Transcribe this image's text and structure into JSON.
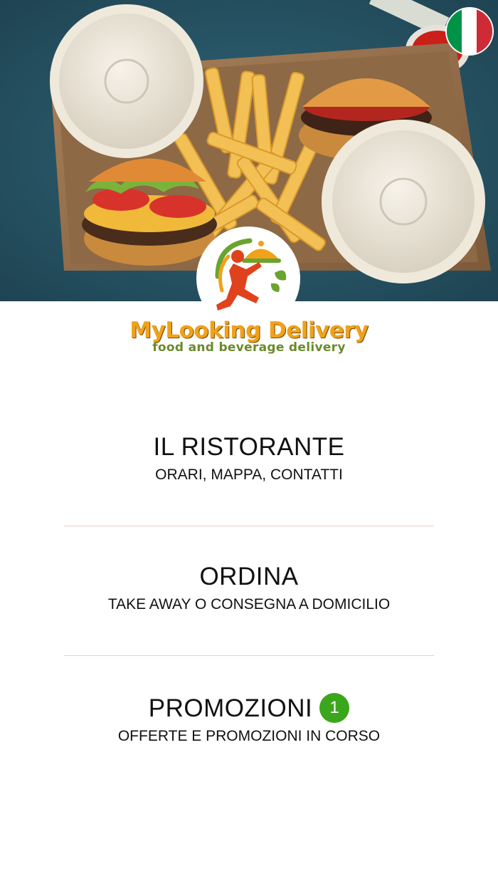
{
  "brand": {
    "name": "MyLooking Delivery",
    "tagline": "food and beverage delivery"
  },
  "language": {
    "flag": "italian-flag-icon",
    "colors": [
      "#009246",
      "#ffffff",
      "#ce2b37"
    ]
  },
  "menu": {
    "restaurant": {
      "title": "IL RISTORANTE",
      "subtitle": "ORARI, MAPPA, CONTATTI"
    },
    "order": {
      "title": "ORDINA",
      "subtitle": "TAKE AWAY O CONSEGNA A DOMICILIO"
    },
    "promotions": {
      "title": "PROMOZIONI",
      "badge": "1",
      "subtitle": "OFFERTE E PROMOZIONI IN CORSO"
    }
  },
  "colors": {
    "badge": "#3aa61b",
    "divider": "#f2c9c9",
    "brand_orange": "#f0a21a",
    "brand_green": "#6b8a2a"
  }
}
